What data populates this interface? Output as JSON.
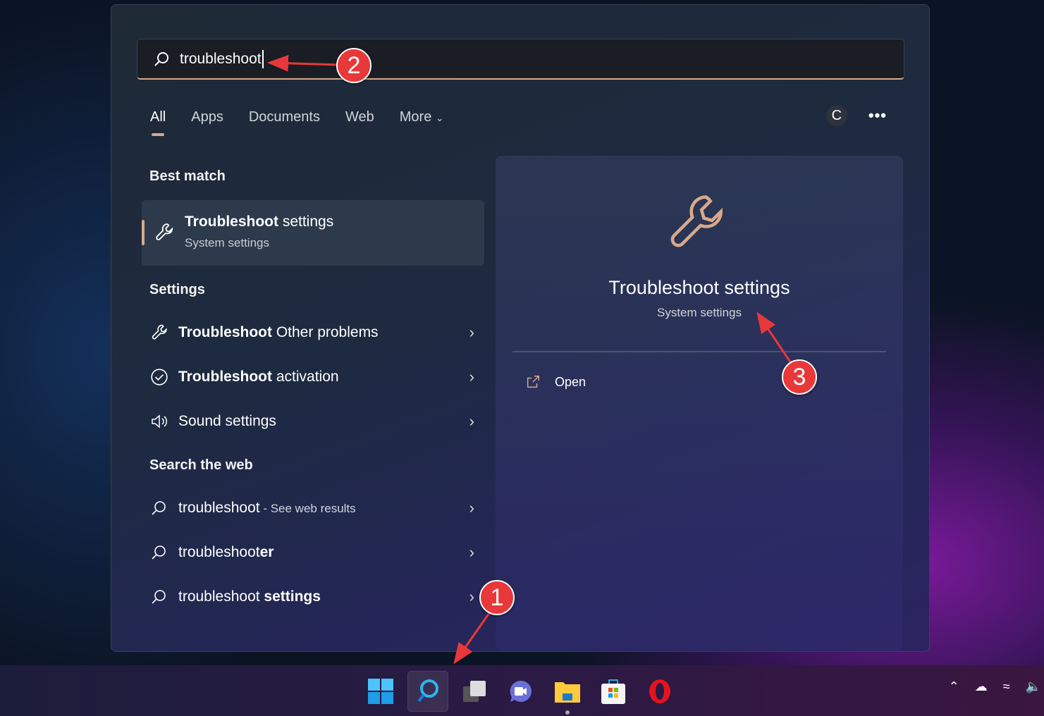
{
  "search": {
    "value": "troubleshoot"
  },
  "tabs": [
    {
      "label": "All"
    },
    {
      "label": "Apps"
    },
    {
      "label": "Documents"
    },
    {
      "label": "Web"
    },
    {
      "label": "More"
    }
  ],
  "avatar_initial": "C",
  "more_options": "•••",
  "best_match": {
    "heading": "Best match",
    "title_bold": "Troubleshoot",
    "title_rest": " settings",
    "subtitle": "System settings"
  },
  "settings": {
    "heading": "Settings",
    "items": [
      {
        "bold": "Troubleshoot",
        "rest": " Other problems",
        "icon": "wrench-icon"
      },
      {
        "bold": "Troubleshoot",
        "rest": " activation",
        "icon": "check-circle-icon"
      },
      {
        "bold": "",
        "rest": "Sound settings",
        "icon": "speaker-icon"
      }
    ]
  },
  "web": {
    "heading": "Search the web",
    "items": [
      {
        "rest": "troubleshoot",
        "extra": " - See web results",
        "bold": ""
      },
      {
        "rest": "troubleshoot",
        "bold": "er",
        "extra": ""
      },
      {
        "rest": "troubleshoot ",
        "bold": "settings",
        "extra": ""
      }
    ]
  },
  "preview": {
    "title": "Troubleshoot settings",
    "subtitle": "System settings",
    "open_label": "Open"
  },
  "annotations": [
    "1",
    "2",
    "3"
  ],
  "accent": "#d8a98c"
}
